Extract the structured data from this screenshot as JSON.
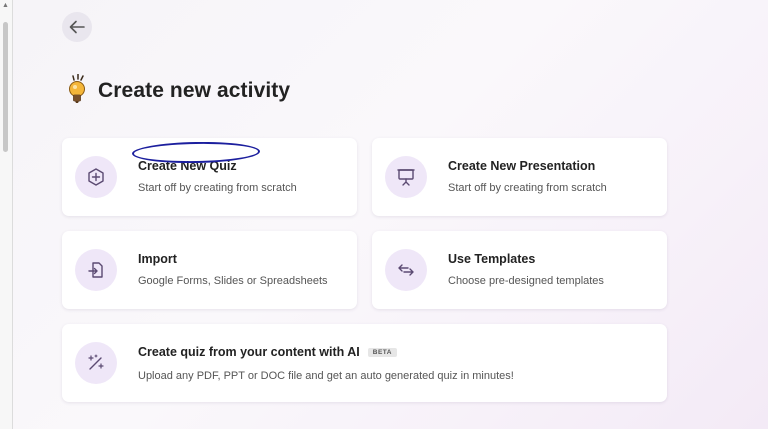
{
  "page": {
    "title": "Create new activity"
  },
  "cards": {
    "new_quiz": {
      "title": "Create New Quiz",
      "subtitle": "Start off by creating from scratch"
    },
    "new_presentation": {
      "title": "Create New Presentation",
      "subtitle": "Start off by creating from scratch"
    },
    "import": {
      "title": "Import",
      "subtitle": "Google Forms, Slides or Spreadsheets"
    },
    "templates": {
      "title": "Use Templates",
      "subtitle": "Choose pre-designed templates"
    },
    "ai_quiz": {
      "title": "Create quiz from your content with AI",
      "badge": "BETA",
      "subtitle": "Upload any PDF, PPT or DOC file and get an auto generated quiz in minutes!"
    }
  },
  "colors": {
    "accent": "#7a3fb5",
    "icon_background": "#efe7f8",
    "annotation": "#1c1f9e"
  },
  "icons": [
    "back-arrow-icon",
    "lightbulb-icon",
    "plus-circle-icon",
    "presentation-icon",
    "import-icon",
    "swap-arrows-icon",
    "magic-wand-icon"
  ]
}
